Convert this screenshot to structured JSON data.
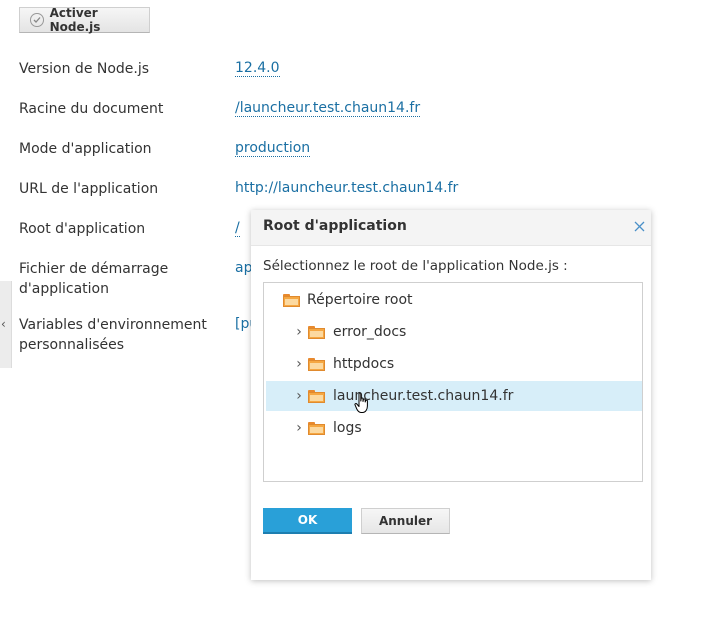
{
  "toolbar": {
    "activate_label": "Activer Node.js"
  },
  "settings": [
    {
      "label": "Version de Node.js",
      "value": "12.4.0",
      "dotted": true
    },
    {
      "label": "Racine du document",
      "value": "/launcheur.test.chaun14.fr",
      "dotted": true
    },
    {
      "label": "Mode d'application",
      "value": "production",
      "dotted": true
    },
    {
      "label": "URL de l'application",
      "value": "http://launcheur.test.chaun14.fr",
      "dotted": false
    },
    {
      "label": "Root d'application",
      "value": "/",
      "dotted": true
    },
    {
      "label": "Fichier de démarrage d'application",
      "value": "ap",
      "dotted": false
    },
    {
      "label": "Variables d'environnement personnalisées",
      "value": "[pu",
      "dotted": false
    }
  ],
  "dialog": {
    "title": "Root d'application",
    "prompt": "Sélectionnez le root de l'application Node.js :",
    "tree": [
      {
        "label": "Répertoire root",
        "level": 0,
        "expandable": false,
        "selected": false
      },
      {
        "label": "error_docs",
        "level": 1,
        "expandable": true,
        "selected": false
      },
      {
        "label": "httpdocs",
        "level": 1,
        "expandable": true,
        "selected": false
      },
      {
        "label": "launcheur.test.chaun14.fr",
        "level": 1,
        "expandable": true,
        "selected": true
      },
      {
        "label": "logs",
        "level": 1,
        "expandable": true,
        "selected": false
      }
    ],
    "ok_label": "OK",
    "cancel_label": "Annuler"
  },
  "colors": {
    "link": "#1a6fa3",
    "primary_button": "#29a0d8",
    "selected_row": "#d7eef9",
    "folder": "#f5a742"
  },
  "icons": {
    "activate": "check-circle-icon",
    "close": "close-icon",
    "folder": "folder-icon",
    "expand": "chevron-right-icon",
    "side_tab": "chevron-left-icon",
    "cursor": "hand-pointer-icon"
  }
}
